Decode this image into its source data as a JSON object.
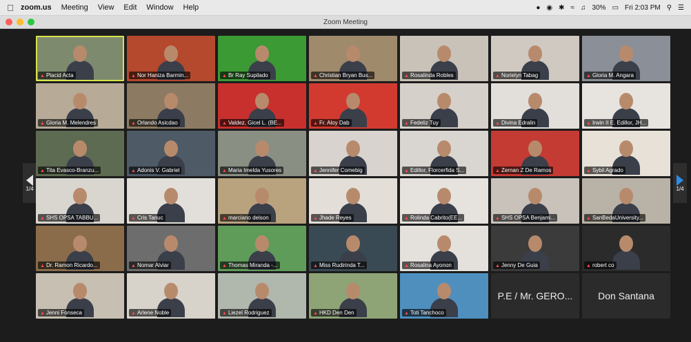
{
  "menubar": {
    "app": "zoom.us",
    "items": [
      "Meeting",
      "View",
      "Edit",
      "Window",
      "Help"
    ],
    "battery": "30%",
    "clock": "Fri 2:03 PM"
  },
  "window": {
    "title": "Zoom Meeting"
  },
  "pager": {
    "prev_label": "1/4",
    "next_label": "1/4"
  },
  "colors": {
    "active_speaker_border": "#d7e34a",
    "next_arrow": "#2f8ce8"
  },
  "participants": [
    {
      "name": "Placid Acta",
      "bg": "#7e8a6e",
      "active": true
    },
    {
      "name": "Nor Haniza Barmin...",
      "bg": "#b5492e"
    },
    {
      "name": "Br Ray Supilado",
      "bg": "#3c9a35"
    },
    {
      "name": "Christian Bryan Bus...",
      "bg": "#a08a6c"
    },
    {
      "name": "Rosalinda Robles",
      "bg": "#c9c2b8"
    },
    {
      "name": "Norielyn Tabag",
      "bg": "#cfc9c2"
    },
    {
      "name": "Gloria M. Angara",
      "bg": "#8b8f97"
    },
    {
      "name": "Gloria M. Melendres",
      "bg": "#b7ab98"
    },
    {
      "name": "Orlando Asicdao",
      "bg": "#8d7a62"
    },
    {
      "name": "Valdez, Gicel L. (BE...",
      "bg": "#c7302d"
    },
    {
      "name": "Fr. Aloy Dab",
      "bg": "#d23a30"
    },
    {
      "name": "Fedeliz Tuy",
      "bg": "#d5d0c9"
    },
    {
      "name": "Divina Edralin",
      "bg": "#e2dfdb"
    },
    {
      "name": "Irwin II E. Edillor, JH...",
      "bg": "#e7e4e0"
    },
    {
      "name": "Tita Evasco-Branzu...",
      "bg": "#5d6b52"
    },
    {
      "name": "Adonis V. Gabriel",
      "bg": "#4f5a67"
    },
    {
      "name": "Maria Imelda Yusores",
      "bg": "#8a8f84"
    },
    {
      "name": "Jennifer Comebig",
      "bg": "#d8d3cf"
    },
    {
      "name": "Edillor, Florcerfida S...",
      "bg": "#d9d6d1"
    },
    {
      "name": "Zernan Z De Ramos",
      "bg": "#c43b34"
    },
    {
      "name": "Sybil Agrado",
      "bg": "#e7e1d8"
    },
    {
      "name": "SHS OPSA TABBU...",
      "bg": "#d9d5cf"
    },
    {
      "name": "Cris Tanuc",
      "bg": "#e2dfda"
    },
    {
      "name": "marciano delson",
      "bg": "#b9a27e"
    },
    {
      "name": "Jhade Reyes",
      "bg": "#e3ded8"
    },
    {
      "name": "Rolinda Cabrito(EE...",
      "bg": "#e6e3de"
    },
    {
      "name": "SHS OPSA Benjami...",
      "bg": "#c8c2bb"
    },
    {
      "name": "SanBedaUniversity...",
      "bg": "#b9b2a6"
    },
    {
      "name": "Dr. Ramon Ricardo...",
      "bg": "#8a6c4b"
    },
    {
      "name": "Nomar Alviar",
      "bg": "#6d6d6d"
    },
    {
      "name": "Thomas Miranda -...",
      "bg": "#5f9c5a"
    },
    {
      "name": "Miss Rudirinda T...",
      "bg": "#3a4a54"
    },
    {
      "name": "Rosalina Ayonon",
      "bg": "#e4e0db"
    },
    {
      "name": "Jenny De Guia",
      "bg": "#3b3b3b"
    },
    {
      "name": "robert co",
      "bg": "#2b2b2b"
    },
    {
      "name": "Jenni Fonseca",
      "bg": "#c7bfb2"
    },
    {
      "name": "Arlene Noble",
      "bg": "#d7d2ca"
    },
    {
      "name": "Liezel Rodriguez",
      "bg": "#b0b7ad"
    },
    {
      "name": "HKD Den Den",
      "bg": "#8ea476"
    },
    {
      "name": "Toti Tanchoco",
      "bg": "#4f8fbe"
    },
    {
      "name": "P.E / Mr. GERO...",
      "bg": "#2b2b2b",
      "text_only": true
    },
    {
      "name": "Don Santana",
      "bg": "#2b2b2b",
      "text_only": true
    }
  ]
}
